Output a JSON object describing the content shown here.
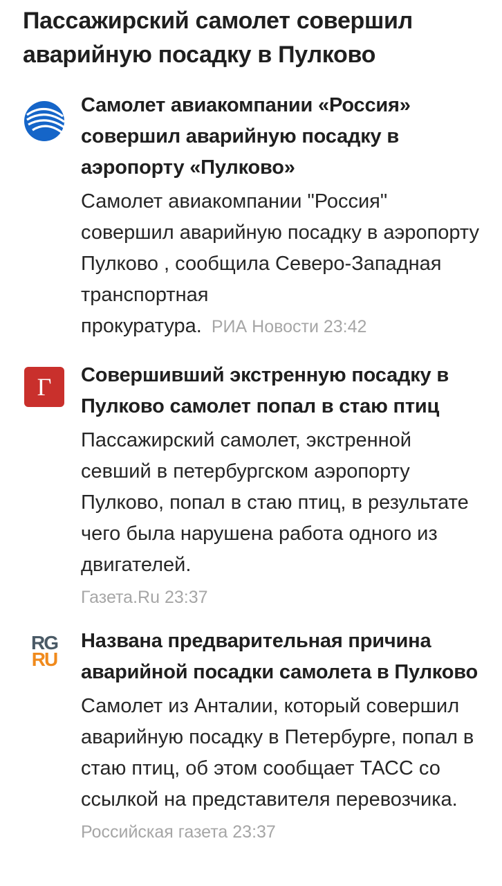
{
  "headline": "Пассажирский самолет совершил аварийную посадку в Пулково",
  "stories": [
    {
      "logo": "ria-novosti-logo",
      "title": "Самолет авиакомпании «Россия» совершил аварийную посадку в аэропорту «Пулково»",
      "snippet": "Самолет авиакомпании \"Россия\" совершил аварийную посадку в аэропорту Пулково , сообщила Северо-Западная транспортная прокуратура.",
      "source": "РИА Новости",
      "time": "23:42"
    },
    {
      "logo": "gazeta-ru-logo",
      "logo_text": "Г",
      "title": "Совершивший экстренную посадку в Пулково самолет попал в стаю птиц",
      "snippet": "Пассажирский самолет, экстренной севший в петербургском аэропорту Пулково, попал в стаю птиц, в результате чего была нарушена работа одного из двигателей.",
      "source": "Газета.Ru",
      "time": "23:37"
    },
    {
      "logo": "rg-ru-logo",
      "logo_text_top": "RG",
      "logo_text_bottom": "RU",
      "title": "Названа предварительная причина аварийной посадки самолета в Пулково",
      "snippet": "Самолет из Анталии, который совершил аварийную посадку в Петербурге, попал в стаю птиц, об этом сообщает ТАСС со ссылкой на представителя перевозчика.",
      "source": "Российская газета",
      "time": "23:37"
    }
  ],
  "colors": {
    "text": "#1f1f1f",
    "meta": "#a6a6a6",
    "ria_blue": "#1565c8",
    "gazeta_red": "#c9302c",
    "rg_dark": "#4a5a66",
    "rg_orange": "#f08a1c"
  }
}
